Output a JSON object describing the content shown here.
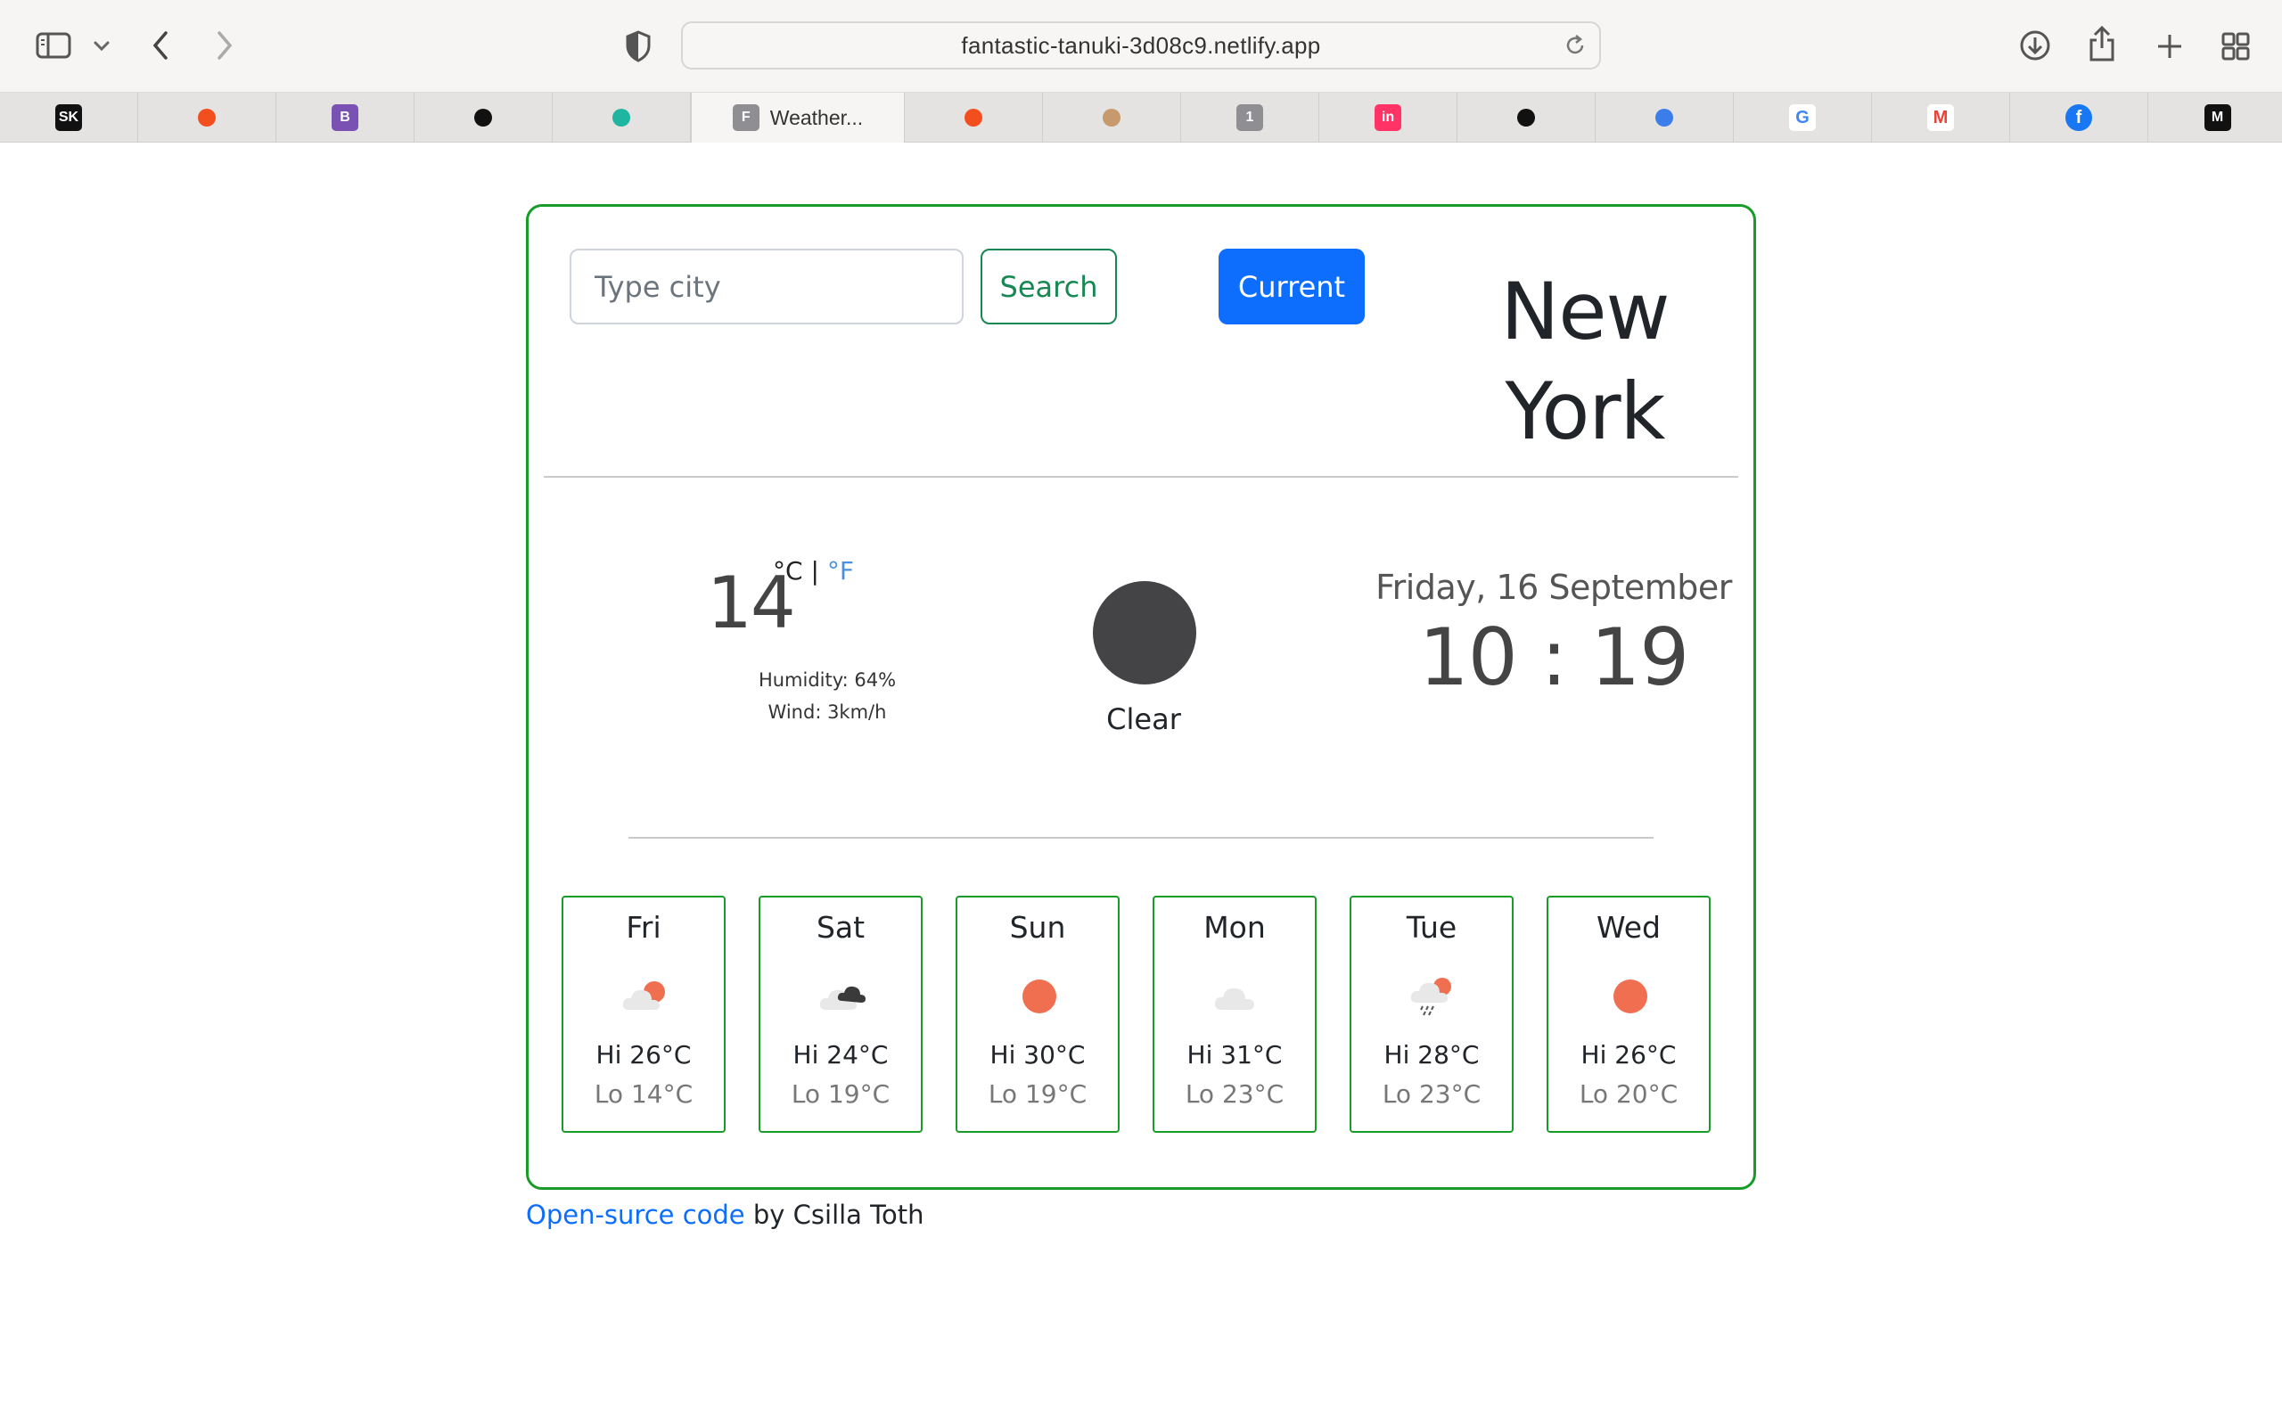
{
  "browser": {
    "url": "fantastic-tanuki-3d08c9.netlify.app",
    "tabs": [
      {
        "icon": "sketch-icon",
        "label": "",
        "badge": "SK",
        "color": "#111111"
      },
      {
        "icon": "figma-icon",
        "label": "",
        "badge": "",
        "color": "#f24e1e"
      },
      {
        "icon": "bootstrap-icon",
        "label": "",
        "badge": "B",
        "color": "#7952b3"
      },
      {
        "icon": "github-icon",
        "label": "",
        "badge": "",
        "color": "#111111"
      },
      {
        "icon": "diamond-icon",
        "label": "",
        "badge": "",
        "color": "#1fb5a0"
      },
      {
        "icon": "f-icon",
        "label": "Weather...",
        "badge": "F",
        "color": "#8e8e93"
      },
      {
        "icon": "figma-icon",
        "label": "",
        "badge": "",
        "color": "#f24e1e"
      },
      {
        "icon": "ninja-icon",
        "label": "",
        "badge": "",
        "color": "#c69a6d"
      },
      {
        "icon": "number-one-icon",
        "label": "",
        "badge": "1",
        "color": "#8e8e93"
      },
      {
        "icon": "invision-icon",
        "label": "",
        "badge": "in",
        "color": "#ff3366"
      },
      {
        "icon": "play-icon",
        "label": "",
        "badge": "",
        "color": "#111111"
      },
      {
        "icon": "flag-icon",
        "label": "",
        "badge": "",
        "color": "#3b7de9"
      },
      {
        "icon": "google-icon",
        "label": "",
        "badge": "G",
        "color": "#4285f4"
      },
      {
        "icon": "gmail-icon",
        "label": "",
        "badge": "M",
        "color": "#ea4335"
      },
      {
        "icon": "facebook-icon",
        "label": "",
        "badge": "f",
        "color": "#1877f2"
      },
      {
        "icon": "medium-icon",
        "label": "",
        "badge": "M",
        "color": "#111111"
      }
    ]
  },
  "weather": {
    "search_placeholder": "Type city",
    "search_label": "Search",
    "current_label": "Current",
    "city_line1": "New",
    "city_line2": "York",
    "temperature": "14",
    "unit_celsius": "°C",
    "unit_separator": "|",
    "unit_fahrenheit": "°F",
    "humidity": "Humidity: 64%",
    "wind": "Wind: 3km/h",
    "description": "Clear",
    "date": "Friday, 16 September",
    "time": "10 : 19",
    "forecast": [
      {
        "day": "Fri",
        "hi": "Hi 26°C",
        "lo": "Lo 14°C",
        "icon": "partly-cloudy-icon"
      },
      {
        "day": "Sat",
        "hi": "Hi 24°C",
        "lo": "Lo 19°C",
        "icon": "broken-clouds-icon"
      },
      {
        "day": "Sun",
        "hi": "Hi 30°C",
        "lo": "Lo 19°C",
        "icon": "sun-icon"
      },
      {
        "day": "Mon",
        "hi": "Hi 31°C",
        "lo": "Lo 23°C",
        "icon": "cloud-icon"
      },
      {
        "day": "Tue",
        "hi": "Hi 28°C",
        "lo": "Lo 23°C",
        "icon": "rain-icon"
      },
      {
        "day": "Wed",
        "hi": "Hi 26°C",
        "lo": "Lo 20°C",
        "icon": "sun-icon"
      }
    ]
  },
  "footer": {
    "link_text": "Open-surce code",
    "rest_text": " by Csilla Toth"
  },
  "colors": {
    "card_border": "#179d27",
    "search_button": "#198754",
    "current_button": "#0d6efd",
    "sun": "#ef6f50"
  }
}
